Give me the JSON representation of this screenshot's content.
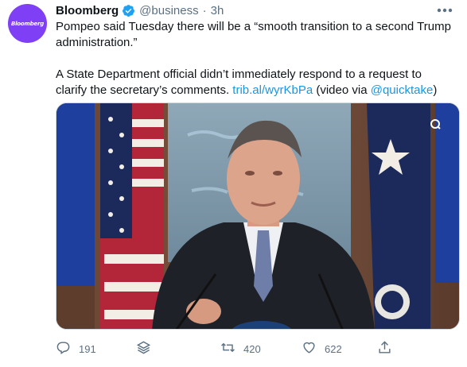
{
  "account": {
    "avatar_text": "Bloomberg",
    "avatar_color": "#7f3ff5",
    "name": "Bloomberg",
    "handle": "@business",
    "separator": "·",
    "time": "3h"
  },
  "tweet": {
    "line1": "Pompeo said Tuesday there will be a “smooth transition to a second Trump administration.”",
    "line2_text": "A State Department official didn’t immediately respond to a request to clarify the secretary’s comments.",
    "link": "trib.al/wyrKbPa",
    "via_prefix": "(video via",
    "mention": "@quicktake",
    "via_suffix": ")"
  },
  "actions": {
    "replies": "191",
    "retweets": "420",
    "likes": "622"
  },
  "colors": {
    "link": "#1b95e0",
    "muted": "#5b7083",
    "verified": "#1da1f2"
  },
  "icons": [
    "verified-badge-icon",
    "more-options-icon",
    "reply-icon",
    "stack-icon",
    "retweet-icon",
    "like-icon",
    "share-icon",
    "video-settings-icon"
  ]
}
